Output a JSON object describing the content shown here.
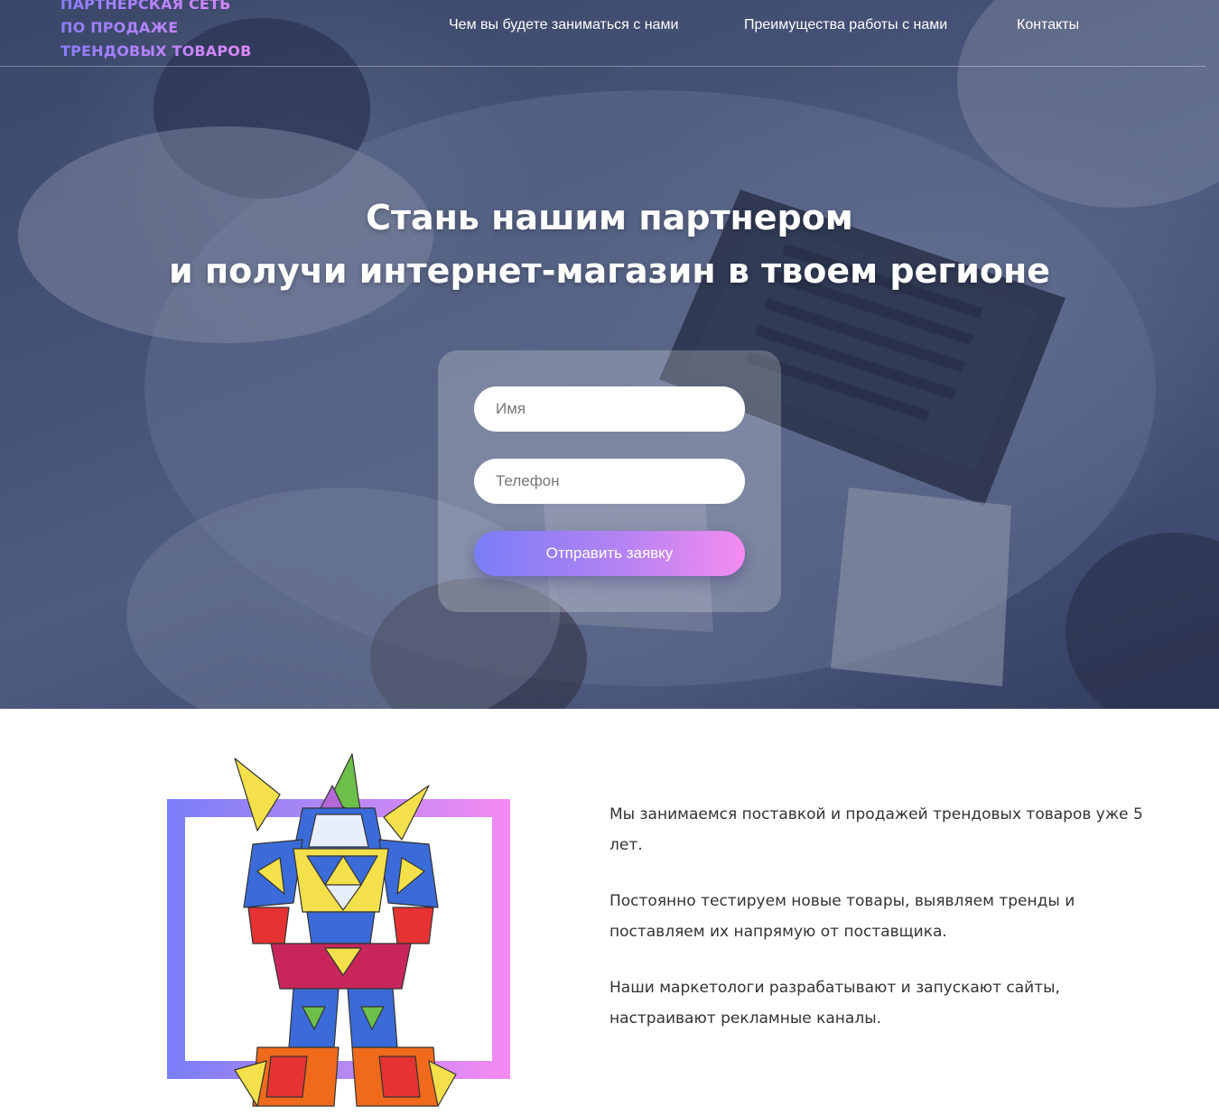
{
  "logo": {
    "lines": [
      "ПАРТНЕРСКАЯ СЕТЬ",
      "ПО ПРОДАЖЕ",
      "ТРЕНДОВЫХ ТОВАРОВ"
    ]
  },
  "nav": {
    "items": [
      {
        "label": "Чем вы будете заниматься с нами"
      },
      {
        "label": "Преимущества работы с нами"
      },
      {
        "label": "Контакты"
      }
    ]
  },
  "hero": {
    "headline_line1": "Стань нашим партнером",
    "headline_line2": "и получи интернет-магазин в твоем регионе"
  },
  "form": {
    "name_placeholder": "Имя",
    "phone_placeholder": "Телефон",
    "submit_label": "Отправить заявку"
  },
  "about": {
    "paragraphs": [
      "Мы занимаемся поставкой и продажей трендовых товаров уже 5 лет.",
      "Постоянно тестируем новые товары, выявляем тренды и поставляем их напрямую от поставщика.",
      "Наши маркетологи разрабатывают и запускают сайты, настраивают рекламные каналы."
    ]
  },
  "colors": {
    "accent_start": "#7a7df8",
    "accent_mid": "#b583f2",
    "accent_end": "#f48bf0",
    "hero_overlay": "#283456"
  }
}
